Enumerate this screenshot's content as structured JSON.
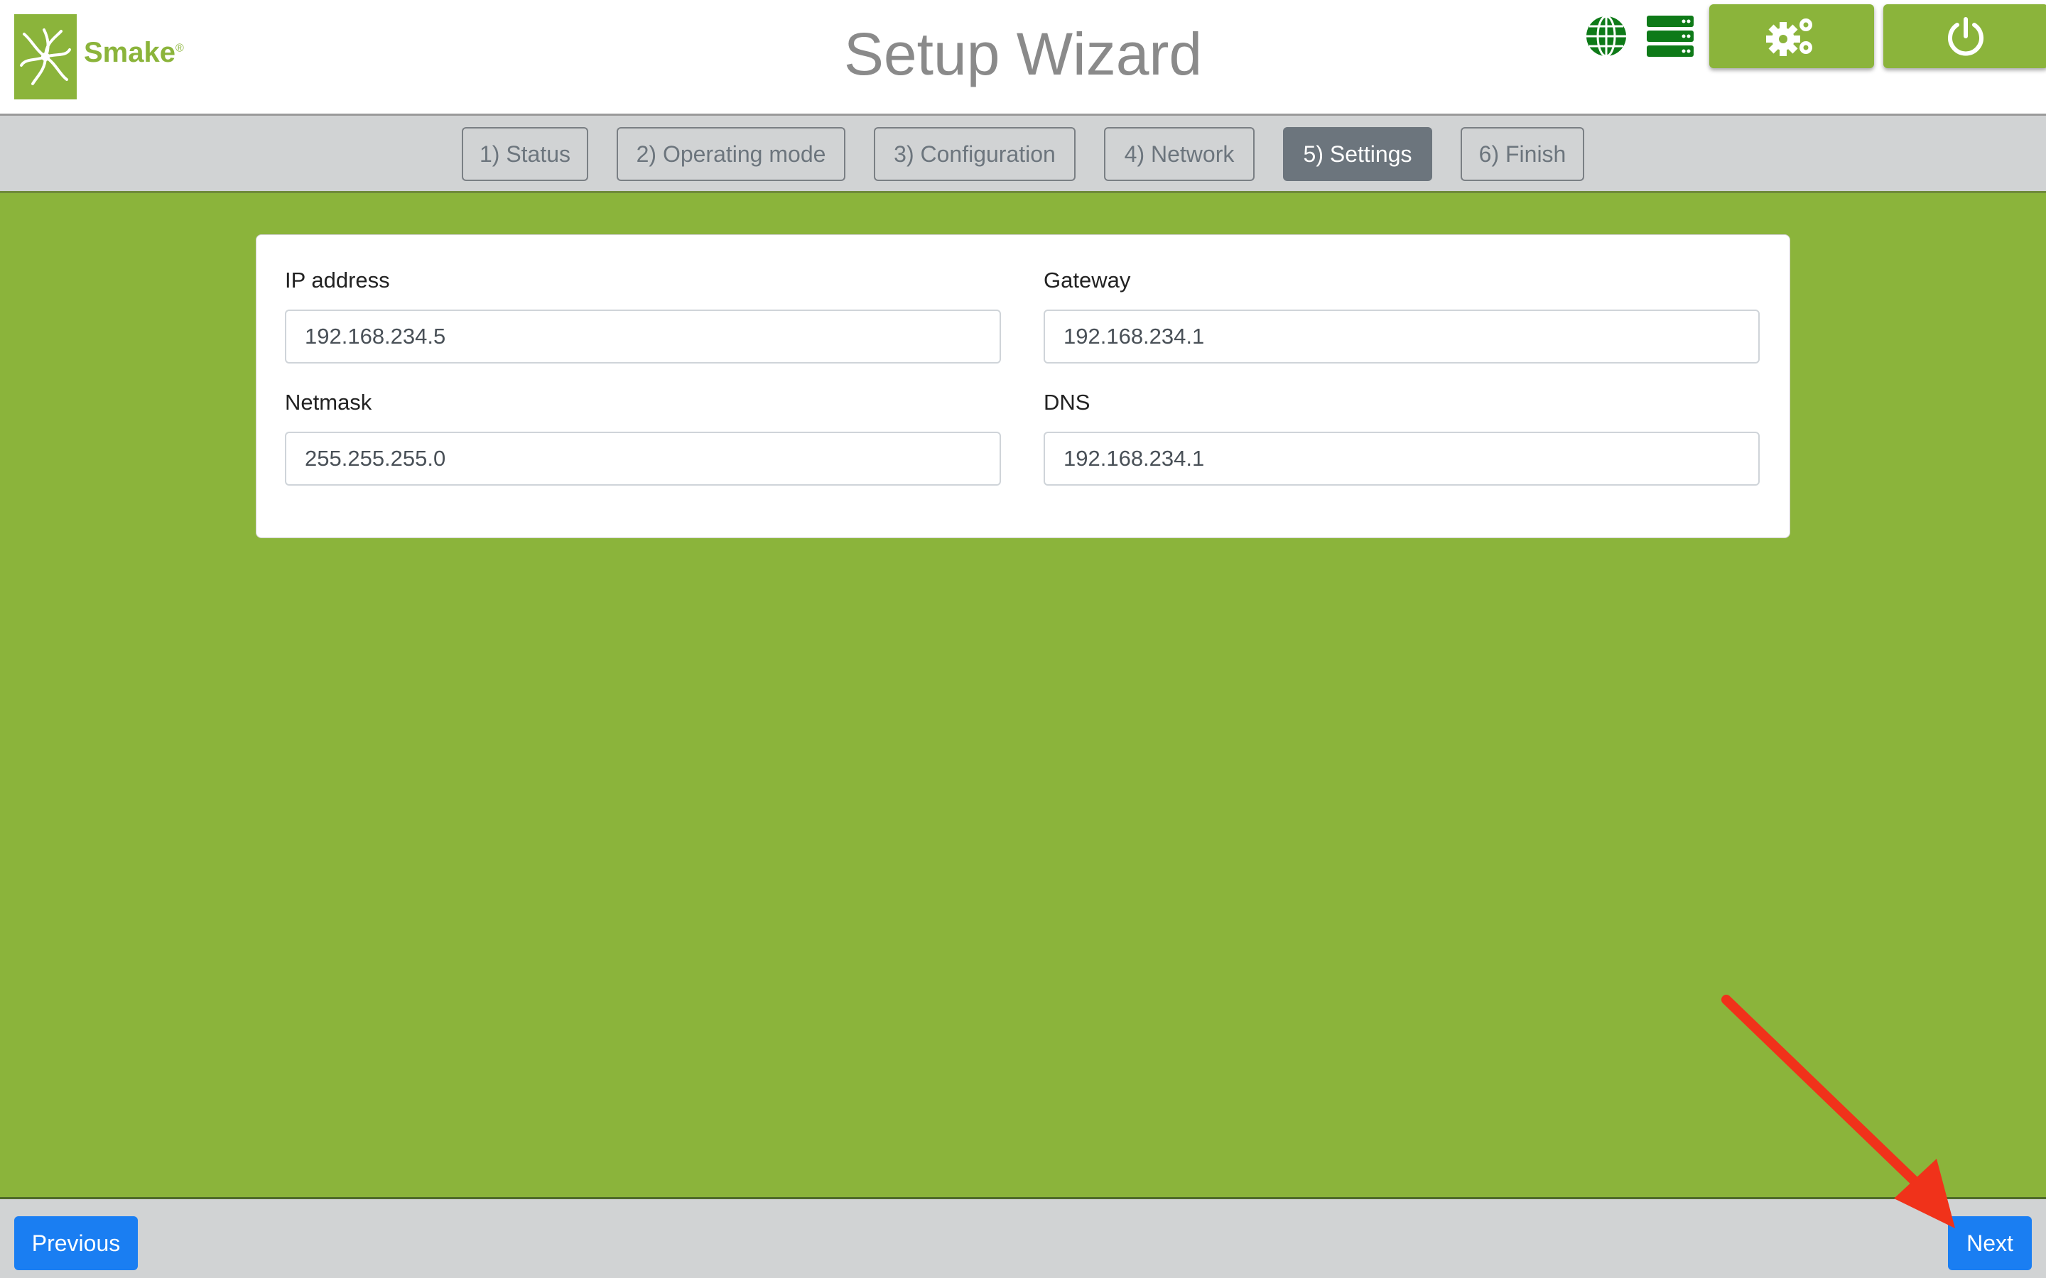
{
  "header": {
    "brand": "Smake",
    "brand_mark": "®",
    "title": "Setup Wizard",
    "icons": [
      "globe-icon",
      "server-icon"
    ],
    "settings_button_icon": "gears-icon",
    "power_button_icon": "power-icon"
  },
  "steps": [
    {
      "label": "1) Status",
      "active": false
    },
    {
      "label": "2) Operating mode",
      "active": false
    },
    {
      "label": "3) Configuration",
      "active": false
    },
    {
      "label": "4) Network",
      "active": false
    },
    {
      "label": "5) Settings",
      "active": true
    },
    {
      "label": "6) Finish",
      "active": false
    }
  ],
  "form": {
    "ip_address": {
      "label": "IP address",
      "value": "192.168.234.5"
    },
    "gateway": {
      "label": "Gateway",
      "value": "192.168.234.1"
    },
    "netmask": {
      "label": "Netmask",
      "value": "255.255.255.0"
    },
    "dns": {
      "label": "DNS",
      "value": "192.168.234.1"
    }
  },
  "footer": {
    "previous_label": "Previous",
    "next_label": "Next"
  },
  "colors": {
    "brand_green": "#8bb43b",
    "primary_blue": "#1a7ef2",
    "active_step": "#6c757d",
    "annotation_arrow": "#f0321a"
  }
}
